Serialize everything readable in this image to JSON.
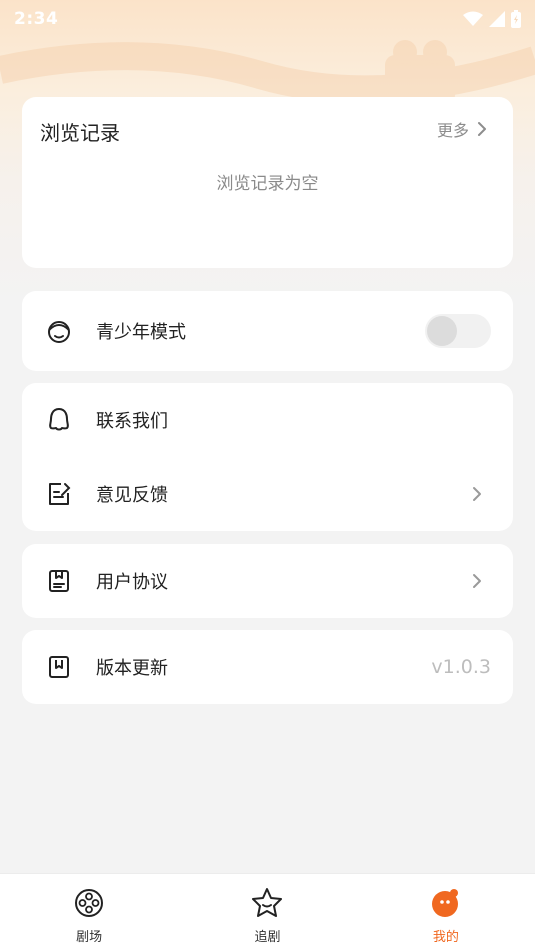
{
  "status_bar": {
    "time": "2:34"
  },
  "history": {
    "title": "浏览记录",
    "more_label": "更多",
    "empty_text": "浏览记录为空"
  },
  "teen_mode": {
    "label": "青少年模式",
    "enabled": false
  },
  "contact": {
    "label": "联系我们"
  },
  "feedback": {
    "label": "意见反馈"
  },
  "agreement": {
    "label": "用户协议"
  },
  "version": {
    "label": "版本更新",
    "value": "v1.0.3"
  },
  "tabs": [
    {
      "label": "剧场",
      "icon": "film-reel-icon",
      "active": false
    },
    {
      "label": "追剧",
      "icon": "star-face-icon",
      "active": false
    },
    {
      "label": "我的",
      "icon": "mascot-icon",
      "active": true
    }
  ],
  "colors": {
    "accent": "#f06820",
    "background": "#f3f3f3",
    "card": "#ffffff"
  }
}
